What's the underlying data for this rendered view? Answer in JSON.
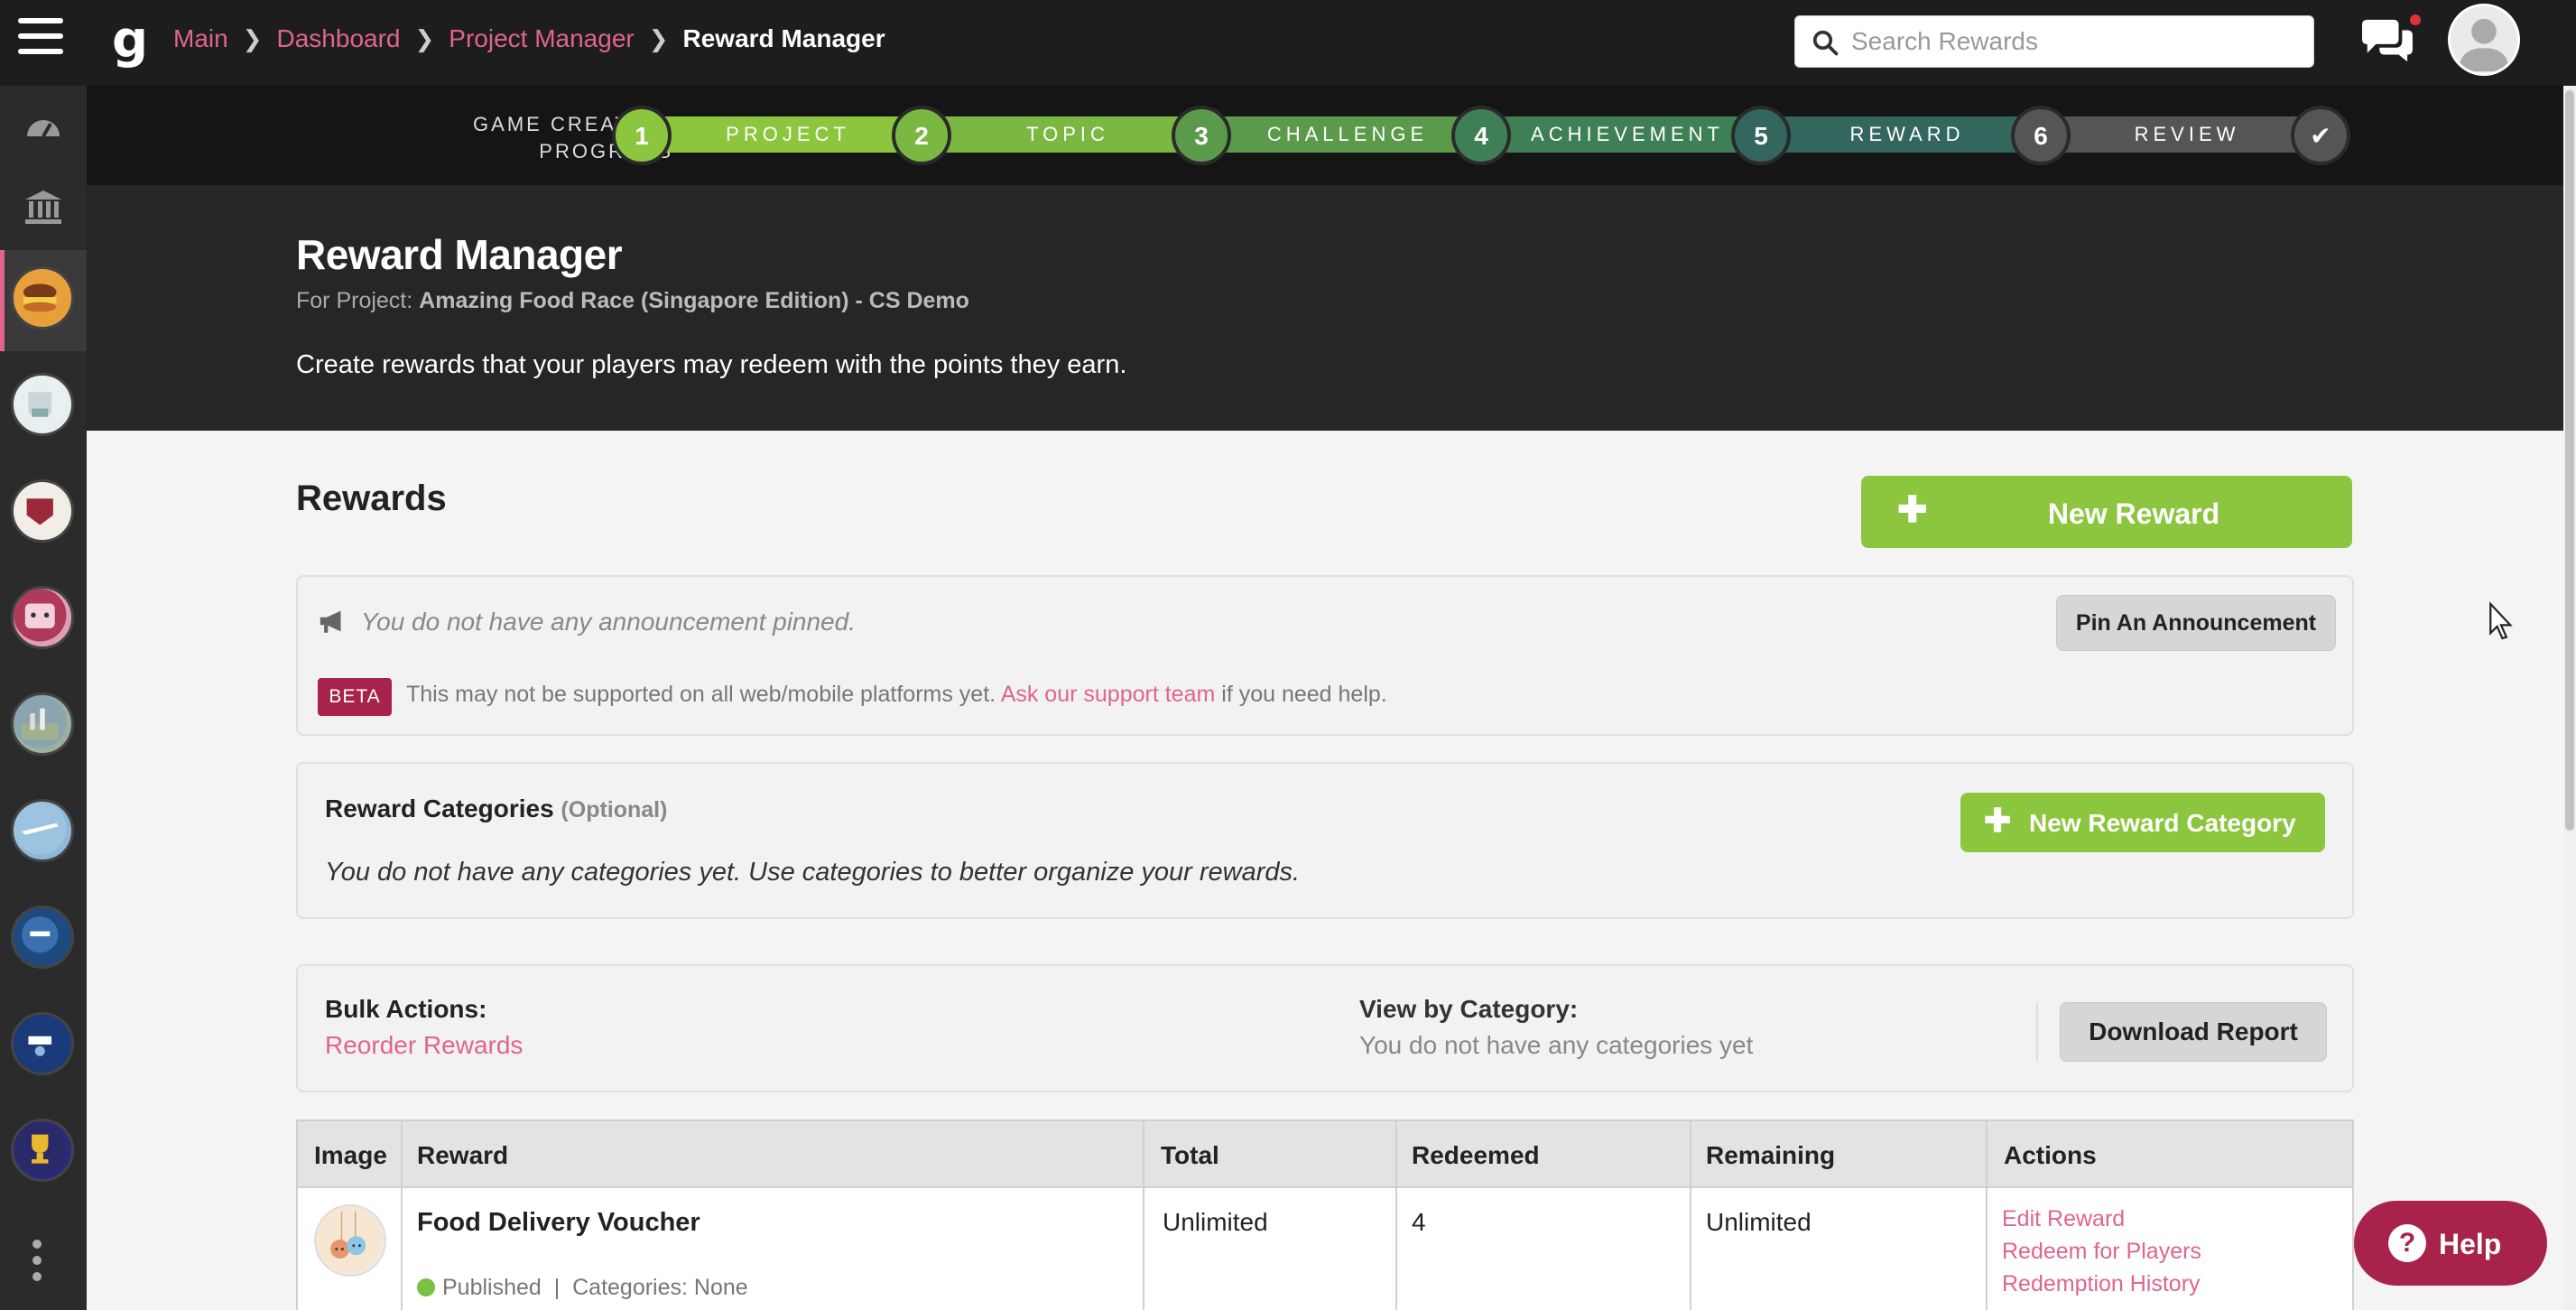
{
  "topbar": {
    "breadcrumb": [
      {
        "label": "Main"
      },
      {
        "label": "Dashboard"
      },
      {
        "label": "Project Manager"
      }
    ],
    "current": "Reward Manager",
    "search_placeholder": "Search Rewards"
  },
  "progress": {
    "label_line1": "GAME CREATION",
    "label_line2": "PROGRESS",
    "steps": [
      {
        "num": "1",
        "label": "PROJECT"
      },
      {
        "num": "2",
        "label": "TOPIC"
      },
      {
        "num": "3",
        "label": "CHALLENGE"
      },
      {
        "num": "4",
        "label": "ACHIEVEMENT"
      },
      {
        "num": "5",
        "label": "REWARD"
      },
      {
        "num": "6",
        "label": "REVIEW"
      }
    ],
    "colors": {
      "step1": "#8cc63e",
      "step2": "#7bb842",
      "step3": "#5a9a4a",
      "step4": "#3f7f56",
      "step5": "#33665c",
      "step6": "#555555"
    }
  },
  "header": {
    "title": "Reward Manager",
    "for_project_label": "For Project:",
    "project_name": "Amazing Food Race (Singapore Edition) - CS Demo",
    "description": "Create rewards that your players may redeem with the points they earn."
  },
  "rewards": {
    "title": "Rewards",
    "new_button": "New Reward"
  },
  "announcement": {
    "empty_text": "You do not have any announcement pinned.",
    "pin_button": "Pin An Announcement",
    "beta_badge": "BETA",
    "beta_text_before": "This may not be supported on all web/mobile platforms yet.",
    "beta_link": "Ask our support team",
    "beta_text_after": "if you need help."
  },
  "categories": {
    "title": "Reward Categories",
    "optional": "(Optional)",
    "empty_text": "You do not have any categories yet. Use categories to better organize your rewards.",
    "new_button": "New Reward Category"
  },
  "bulk": {
    "title": "Bulk Actions:",
    "reorder_link": "Reorder Rewards",
    "view_title": "View by Category:",
    "view_desc": "You do not have any categories yet",
    "download_button": "Download Report"
  },
  "table": {
    "headers": [
      "Image",
      "Reward",
      "Total",
      "Redeemed",
      "Remaining",
      "Actions"
    ],
    "rows": [
      {
        "name": "Food Delivery Voucher",
        "status": "Published",
        "categories": "Categories: None",
        "total": "Unlimited",
        "redeemed": "4",
        "remaining": "Unlimited",
        "actions": [
          "Edit Reward",
          "Redeem for Players",
          "Redemption History"
        ]
      }
    ]
  },
  "help": {
    "label": "Help"
  },
  "colors": {
    "accent_pink": "#e0648e",
    "green": "#8cc63e",
    "beta_red": "#a8234b"
  }
}
